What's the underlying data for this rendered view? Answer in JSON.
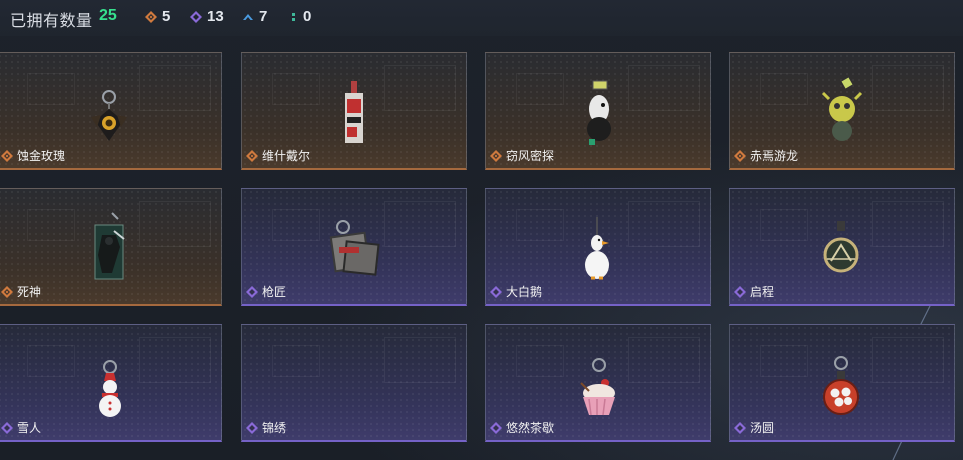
{
  "header": {
    "title": "已拥有数量",
    "total": "25",
    "stats": [
      {
        "icon": "orange-diamond-icon",
        "value": "5",
        "color": "#d07a3e"
      },
      {
        "icon": "purple-diamond-icon",
        "value": "13",
        "color": "#8a6ad8"
      },
      {
        "icon": "blue-chevron-icon",
        "value": "7",
        "color": "#4a9be0"
      },
      {
        "icon": "green-dots-icon",
        "value": "0",
        "color": "#3fb89a"
      }
    ]
  },
  "colors": {
    "orange": "#d07a3e",
    "purple": "#8a6ad8",
    "accent_green": "#37e08e"
  },
  "cards": [
    {
      "name": "蚀金玫瑰",
      "rarity": "orange",
      "icon": "gold-rose-charm-icon"
    },
    {
      "name": "维什戴尔",
      "rarity": "orange",
      "icon": "tag-charm-icon"
    },
    {
      "name": "窃风密探",
      "rarity": "orange",
      "icon": "bird-agent-charm-icon"
    },
    {
      "name": "赤焉游龙",
      "rarity": "orange",
      "icon": "dragon-charm-icon"
    },
    {
      "name": "死神",
      "rarity": "orange",
      "icon": "reaper-card-charm-icon"
    },
    {
      "name": "枪匠",
      "rarity": "purple",
      "icon": "gunsmith-tag-charm-icon"
    },
    {
      "name": "大白鹅",
      "rarity": "purple",
      "icon": "white-goose-charm-icon"
    },
    {
      "name": "启程",
      "rarity": "purple",
      "icon": "departure-ring-charm-icon"
    },
    {
      "name": "雪人",
      "rarity": "purple",
      "icon": "snowman-charm-icon"
    },
    {
      "name": "锦绣",
      "rarity": "purple",
      "icon": "embroidery-charm-icon"
    },
    {
      "name": "悠然茶歇",
      "rarity": "purple",
      "icon": "cupcake-charm-icon"
    },
    {
      "name": "汤圆",
      "rarity": "purple",
      "icon": "tangyuan-bowl-charm-icon"
    }
  ]
}
